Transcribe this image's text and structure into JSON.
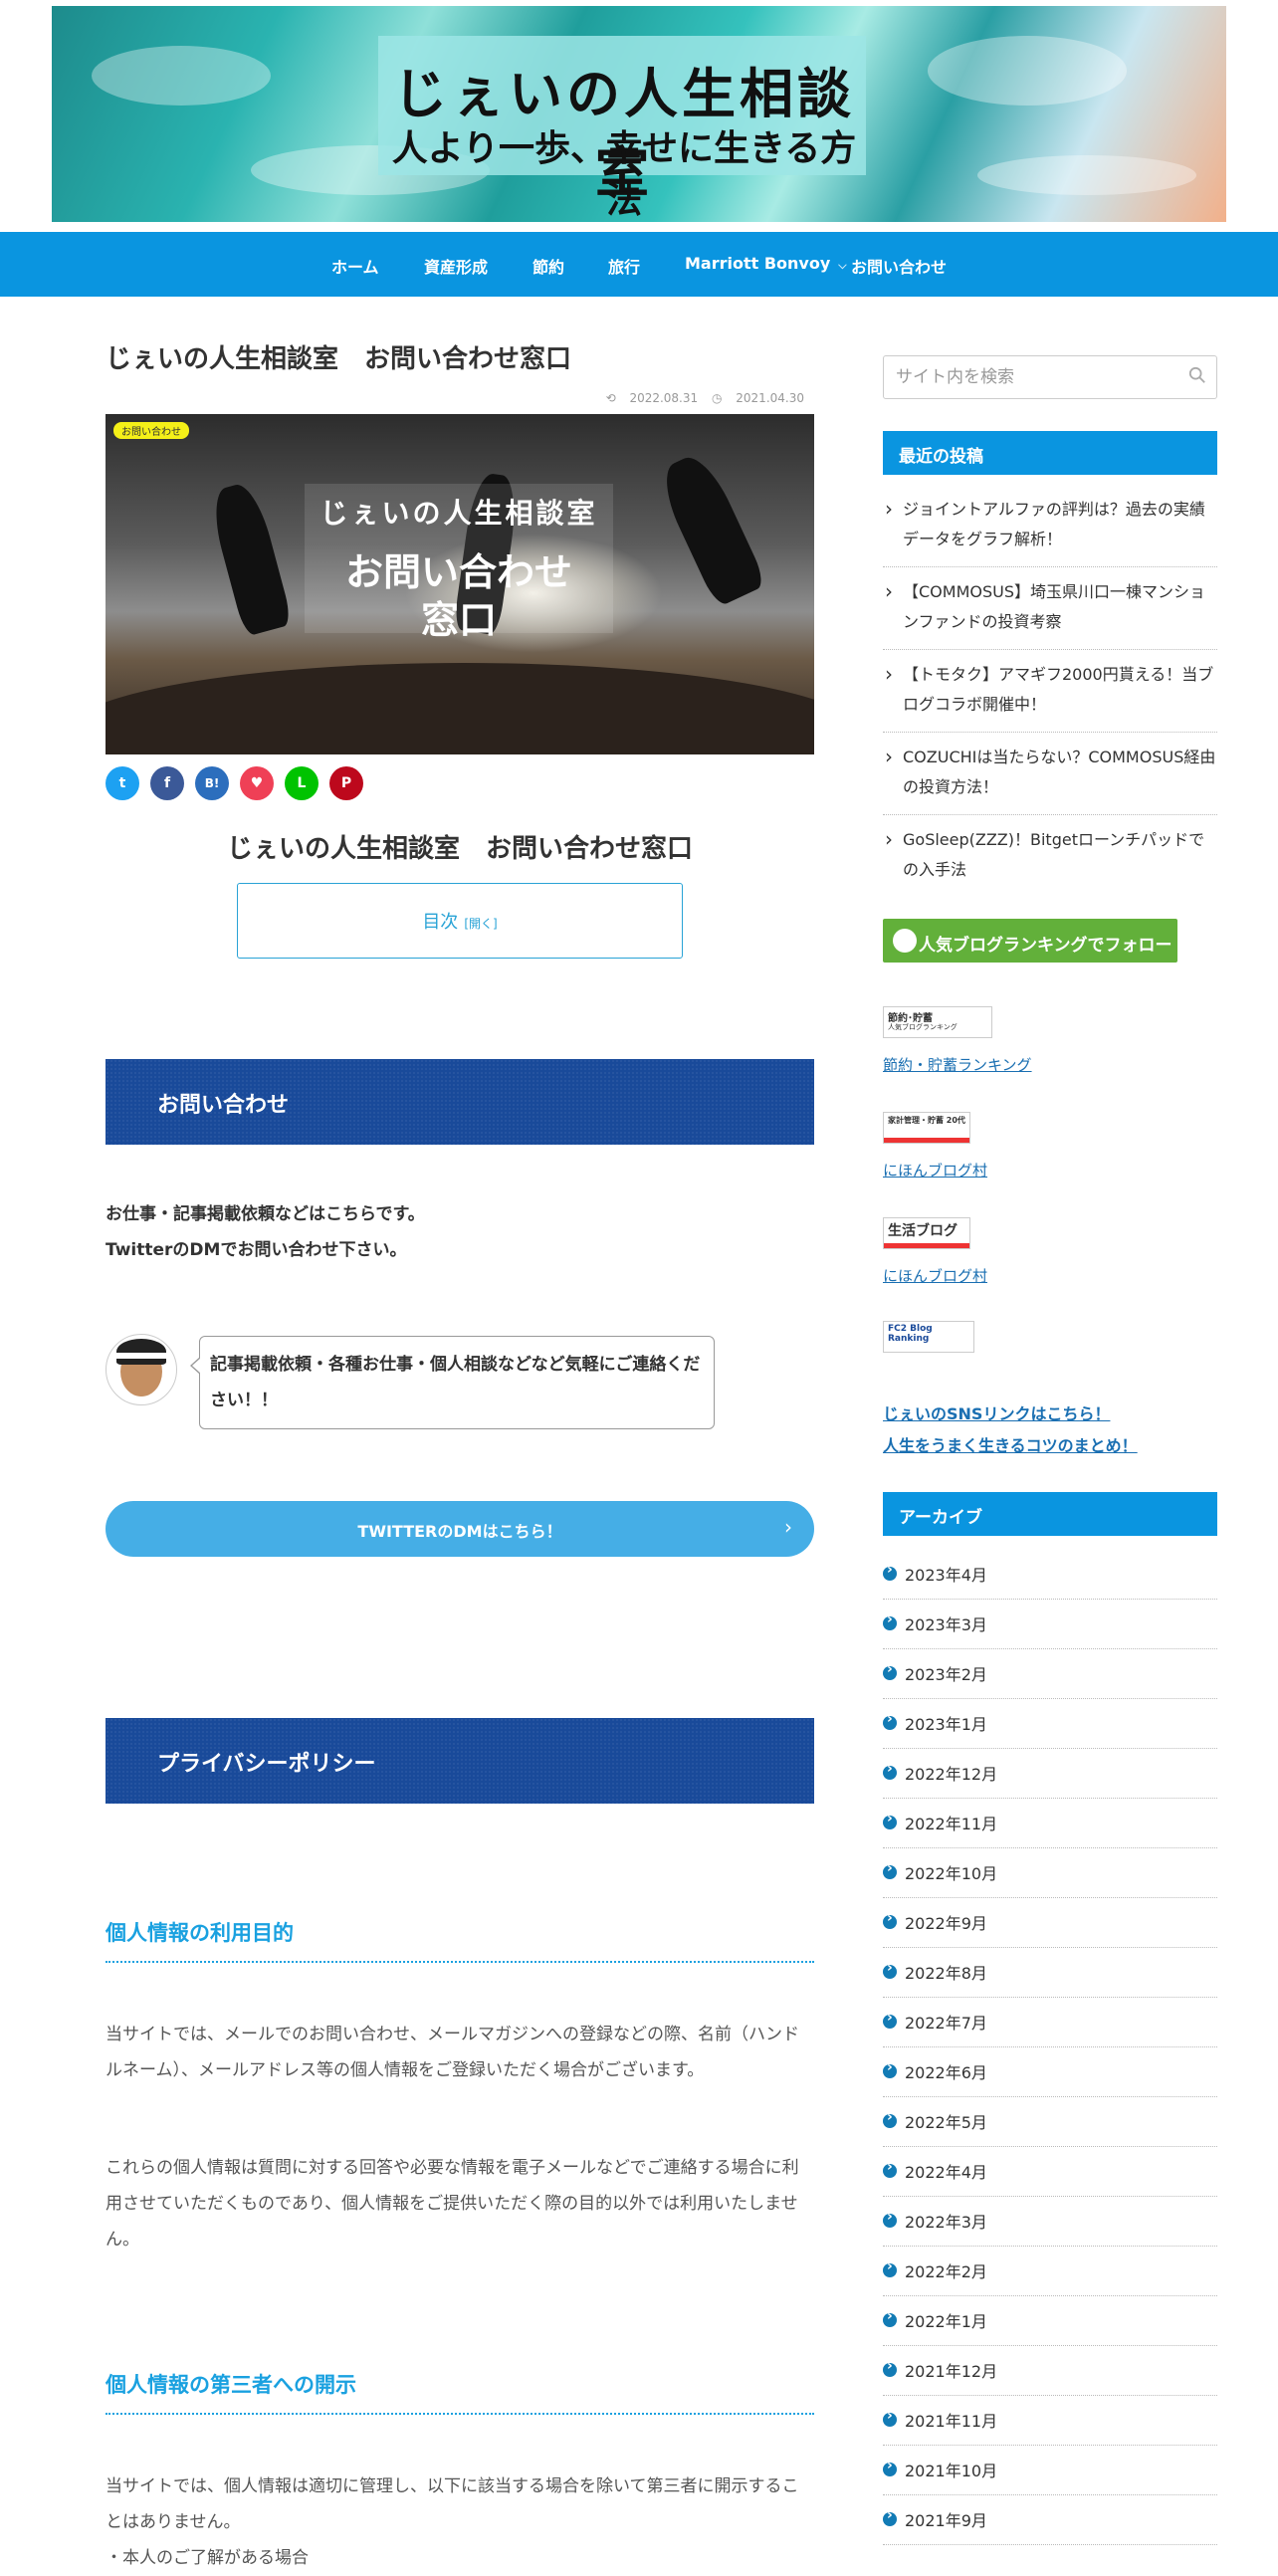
{
  "header": {
    "title": "じぇいの人生相談室",
    "subtitle": "人より一歩、幸せに生きる方法"
  },
  "nav": {
    "items": [
      {
        "label": "ホーム"
      },
      {
        "label": "資産形成"
      },
      {
        "label": "節約"
      },
      {
        "label": "旅行"
      },
      {
        "label": "Marriott Bonvoy"
      },
      {
        "label": "お問い合わせ"
      }
    ]
  },
  "article": {
    "title": "じぇいの人生相談室　お問い合わせ窓口",
    "updated": "2022.08.31",
    "published": "2021.04.30",
    "category": "お問い合わせ",
    "eyecatch": {
      "line1": "じぇいの人生相談室",
      "line2": "お問い合わせ",
      "line3": "窓口"
    },
    "share": {
      "twitter": "t",
      "facebook": "f",
      "hatena": "B!",
      "pocket": "♥",
      "line": "L",
      "pinterest": "P"
    },
    "heading": "じぇいの人生相談室　お問い合わせ窓口",
    "toc": {
      "label": "目次",
      "toggle": "[開く]"
    },
    "contact": {
      "heading": "お問い合わせ",
      "line1": "お仕事・記事掲載依頼などはこちらです。",
      "line2": "TwitterのDMでお問い合わせ下さい。",
      "bubble": "記事掲載依頼・各種お仕事・個人相談などなど気軽にご連絡ください！！",
      "button": "TWITTERのDMはこちら！"
    },
    "privacy": {
      "heading": "プライバシーポリシー",
      "h3_1": "個人情報の利用目的",
      "p1": "当サイトでは、メールでのお問い合わせ、メールマガジンへの登録などの際、名前（ハンドルネーム）、メールアドレス等の個人情報をご登録いただく場合がございます。",
      "p2": "これらの個人情報は質問に対する回答や必要な情報を電子メールなどでご連絡する場合に利用させていただくものであり、個人情報をご提供いただく際の目的以外では利用いたしません。",
      "h3_2": "個人情報の第三者への開示",
      "p3": "当サイトでは、個人情報は適切に管理し、以下に該当する場合を除いて第三者に開示することはありません。",
      "p4": "・本人のご了解がある場合"
    }
  },
  "sidebar": {
    "search_placeholder": "サイト内を検索",
    "recent_title": "最近の投稿",
    "recent": [
      "ジョイントアルファの評判は？過去の実績データをグラフ解析！",
      "【COMMOSUS】埼玉県川口一棟マンションファンドの投資考察",
      "【トモタク】アマギフ2000円貰える！当ブログコラボ開催中！",
      "COZUCHIは当たらない？COMMOSUS経由の投資方法！",
      "GoSleep(ZZZ)！Bitgetローンチパッドでの入手法"
    ],
    "ranking_button": "人気ブログランキングでフォロー",
    "banners": [
      {
        "badge": "節約･貯蓄",
        "badge2": "人気ブログランキング",
        "link": "節約・貯蓄ランキング"
      },
      {
        "badge": "家計管理・貯蓄 20代",
        "badge2": "",
        "link": "にほんブログ村"
      },
      {
        "badge": "生活ブログ",
        "badge2": "",
        "link": "にほんブログ村"
      },
      {
        "badge": "FC2 Blog Ranking",
        "badge2": "",
        "link": ""
      }
    ],
    "sns_link": "じぇいのSNSリンクはこちら！",
    "tips_link": "人生をうまく生きるコツのまとめ！",
    "archive_title": "アーカイブ",
    "archives": [
      "2023年4月",
      "2023年3月",
      "2023年2月",
      "2023年1月",
      "2022年12月",
      "2022年11月",
      "2022年10月",
      "2022年9月",
      "2022年8月",
      "2022年7月",
      "2022年6月",
      "2022年5月",
      "2022年4月",
      "2022年3月",
      "2022年2月",
      "2022年1月",
      "2021年12月",
      "2021年11月",
      "2021年10月",
      "2021年9月"
    ]
  },
  "colors": {
    "nav": "#0a95e0",
    "section": "#194a9a",
    "accent": "#1aa1e0",
    "button": "#45aee6",
    "ranking": "#62b03a"
  }
}
